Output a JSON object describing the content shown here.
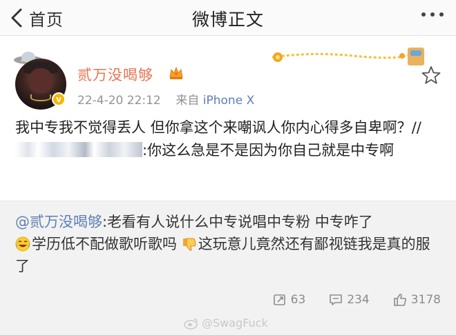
{
  "nav": {
    "back_label": "首页",
    "title": "微博正文"
  },
  "post": {
    "username": "贰万没喝够",
    "time": "22-4-20 22:12",
    "source_prefix": "来自",
    "source": "iPhone X",
    "text_part1": "我中专我不觉得丢人 但你拿这个来嘲讽人你内心得多自卑啊？",
    "text_part2": "//",
    "text_part3": ":你这么急是不是因为你自己就是中专啊"
  },
  "repost": {
    "mention": "@贰万没喝够",
    "text_part1": ":老看有人说什么中专说唱中专粉 中专咋了",
    "text_part2": "学历低不配做歌听歌吗",
    "text_part3": "这玩意儿竟然还有鄙视链我是真的服了",
    "emoji_1": "laugh-cry-emoji",
    "emoji_2": "thumbs-down-emoji",
    "reposts": "63",
    "comments": "234",
    "likes": "3178"
  },
  "watermark": "@SwagFuck",
  "colors": {
    "username": "#eb7350",
    "link": "#5d7fb5",
    "meta": "#939393",
    "repost_bg": "#f2f2f2",
    "verified": "#f7b500"
  }
}
